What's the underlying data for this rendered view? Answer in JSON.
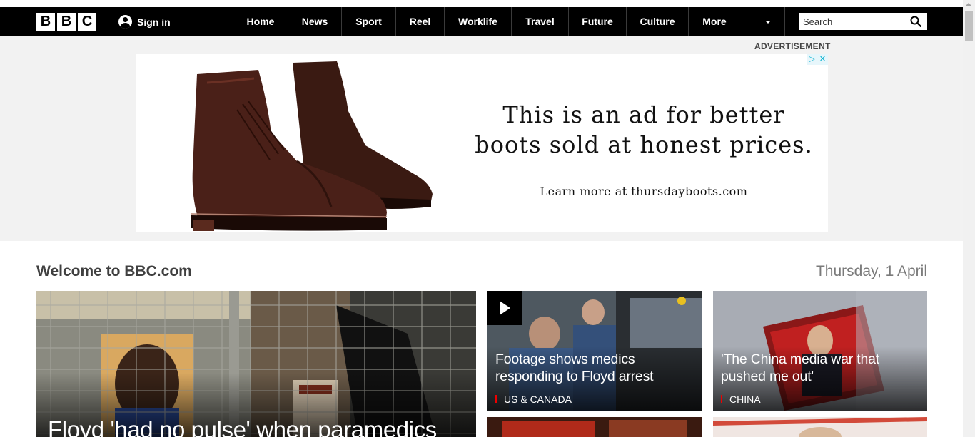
{
  "nav": {
    "logo": [
      "B",
      "B",
      "C"
    ],
    "signin_label": "Sign in",
    "items": [
      "Home",
      "News",
      "Sport",
      "Reel",
      "Worklife",
      "Travel",
      "Future",
      "Culture",
      "More"
    ],
    "search_placeholder": "Search"
  },
  "ad": {
    "label": "ADVERTISEMENT",
    "headline_line1": "This is an ad for better",
    "headline_line2": "boots sold at honest prices.",
    "cta": "Learn more at thursdayboots.com",
    "adchoices_icon": "adchoices-icon",
    "close_icon": "close-icon"
  },
  "welcome": {
    "title": "Welcome to BBC.com",
    "date": "Thursday, 1 April"
  },
  "stories": {
    "main": {
      "title": "Floyd 'had no pulse' when paramedics"
    },
    "second": {
      "title_line1": "Footage shows medics",
      "title_line2": "responding to Floyd arrest",
      "tag": "US & CANADA",
      "video": true
    },
    "third": {
      "title_line1": "'The China media war that",
      "title_line2": "pushed me out'",
      "tag": "CHINA"
    }
  },
  "colors": {
    "nav_bg": "#000000",
    "ad_zone_bg": "#f2f2f2",
    "tag_accent": "#ee0000"
  }
}
